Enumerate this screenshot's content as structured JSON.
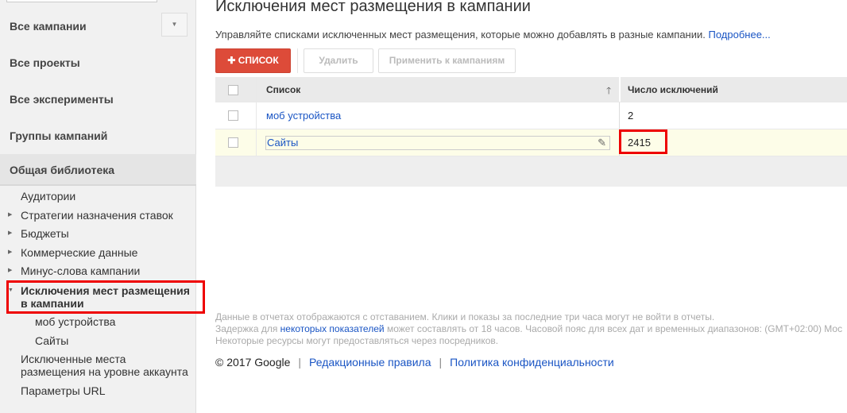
{
  "sidebar": {
    "nav": [
      "Все кампании",
      "Все проекты",
      "Все эксперименты",
      "Группы кампаний"
    ],
    "library": "Общая библиотека",
    "items": [
      "Аудитории",
      "Стратегии назначения ставок",
      "Бюджеты",
      "Коммерческие данные",
      "Минус-слова кампании"
    ],
    "active_line1": "Исключения мест размещения",
    "active_line2": "в кампании",
    "children": [
      "моб устройства",
      "Сайты"
    ],
    "account_line1": "Исключенные места",
    "account_line2": "размещения на уровне аккаунта",
    "url_params": "Параметры URL"
  },
  "main": {
    "title": "Исключения мест размещения в кампании",
    "description": "Управляйте списками исключенных мест размещения, которые можно добавлять в разные кампании.",
    "more_link": "Подробнее...",
    "add_button": "СПИСОК",
    "delete_button": "Удалить",
    "apply_button": "Применить к кампаниям",
    "columns": [
      "Список",
      "Число исключений"
    ],
    "rows": [
      {
        "name": "моб устройства",
        "count": "2"
      },
      {
        "name": "Сайты",
        "count": "2415"
      }
    ]
  },
  "footer": {
    "note1": "Данные в отчетах отображаются с отставанием. Клики и показы за последние три часа могут не войти в отчеты.",
    "note2_a": "Задержка для",
    "note2_link": "некоторых показателей",
    "note2_b": "может составлять от 18 часов. Часовой пояс для всех дат и временных диапазонов: (GMT+02:00) Мос",
    "note3": "Некоторые ресурсы могут предоставляться через посредников.",
    "copyright": "© 2017 Google",
    "link1": "Редакционные правила",
    "link2": "Политика конфиденциальности"
  }
}
